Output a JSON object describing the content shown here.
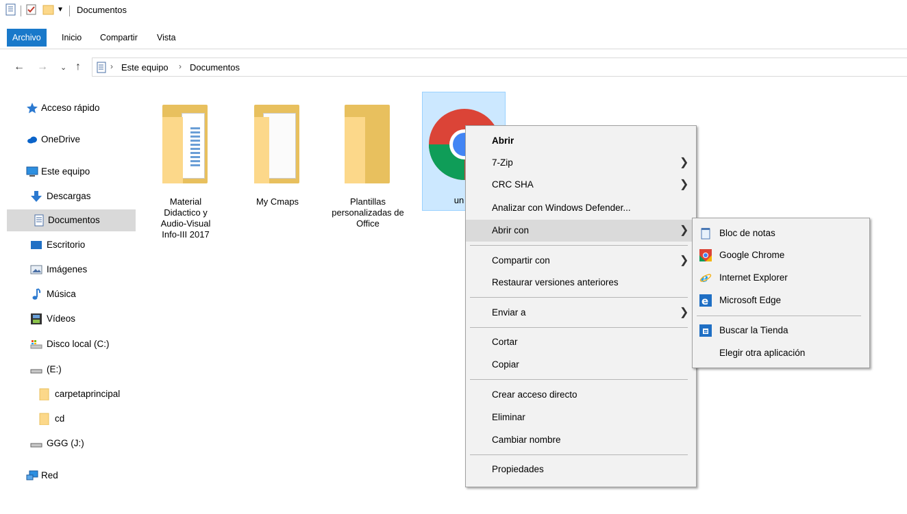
{
  "window": {
    "title": "Documentos"
  },
  "ribbon": {
    "tabs": [
      "Archivo",
      "Inicio",
      "Compartir",
      "Vista"
    ],
    "active_index": 0,
    "accent": "#1979ca"
  },
  "address": {
    "crumbs": [
      "Este equipo",
      "Documentos"
    ]
  },
  "sidebar": {
    "items": [
      {
        "label": "Acceso rápido",
        "icon": "star-icon"
      },
      {
        "label": "OneDrive",
        "icon": "cloud-icon"
      },
      {
        "label": "Este equipo",
        "icon": "computer-icon"
      },
      {
        "label": "Descargas",
        "icon": "download-arrow-icon"
      },
      {
        "label": "Documentos",
        "icon": "document-icon"
      },
      {
        "label": "Escritorio",
        "icon": "desktop-icon"
      },
      {
        "label": "Imágenes",
        "icon": "pictures-icon"
      },
      {
        "label": "Música",
        "icon": "music-note-icon"
      },
      {
        "label": "Vídeos",
        "icon": "film-icon"
      },
      {
        "label": "Disco local (C:)",
        "icon": "local-disk-icon"
      },
      {
        "label": "(E:)",
        "icon": "drive-icon"
      },
      {
        "label": "carpetaprincipal",
        "icon": "folder-icon"
      },
      {
        "label": "cd",
        "icon": "folder-icon"
      },
      {
        "label": "GGG (J:)",
        "icon": "drive-icon"
      },
      {
        "label": "Red",
        "icon": "network-icon"
      }
    ],
    "selected_label": "Documentos"
  },
  "files": [
    {
      "name": "Material Didactico y Audio-Visual Info-III 2017",
      "lines": [
        "Material",
        "Didactico y",
        "Audio-Visual",
        "Info-III 2017"
      ]
    },
    {
      "name": "My Cmaps",
      "lines": [
        "My Cmaps"
      ]
    },
    {
      "name": "Plantillas personalizadas de Office",
      "lines": [
        "Plantillas",
        "personalizadas de",
        "Office"
      ]
    },
    {
      "name": "un",
      "lines": [
        "un"
      ],
      "selected": true,
      "icon": "chrome-icon"
    }
  ],
  "context_menu": {
    "items": [
      {
        "label": "Abrir",
        "bold": true
      },
      {
        "label": "7-Zip",
        "submenu": true
      },
      {
        "label": "CRC SHA",
        "submenu": true
      },
      {
        "label": "Analizar con Windows Defender..."
      },
      {
        "label": "Abrir con",
        "submenu": true,
        "hover": true
      },
      {
        "label": "Compartir con",
        "submenu": true
      },
      {
        "label": "Restaurar versiones anteriores"
      },
      {
        "label": "Enviar a",
        "submenu": true
      },
      {
        "label": "Cortar"
      },
      {
        "label": "Copiar"
      },
      {
        "label": "Crear acceso directo"
      },
      {
        "label": "Eliminar"
      },
      {
        "label": "Cambiar nombre"
      },
      {
        "label": "Propiedades"
      }
    ]
  },
  "open_with_menu": {
    "items": [
      {
        "label": "Bloc de notas",
        "icon": "notepad-icon"
      },
      {
        "label": "Google Chrome",
        "icon": "chrome-icon"
      },
      {
        "label": "Internet Explorer",
        "icon": "internet-explorer-icon"
      },
      {
        "label": "Microsoft Edge",
        "icon": "edge-icon"
      },
      {
        "label": "Buscar la Tienda",
        "icon": "store-icon"
      },
      {
        "label": "Elegir otra aplicación",
        "icon": ""
      }
    ]
  }
}
